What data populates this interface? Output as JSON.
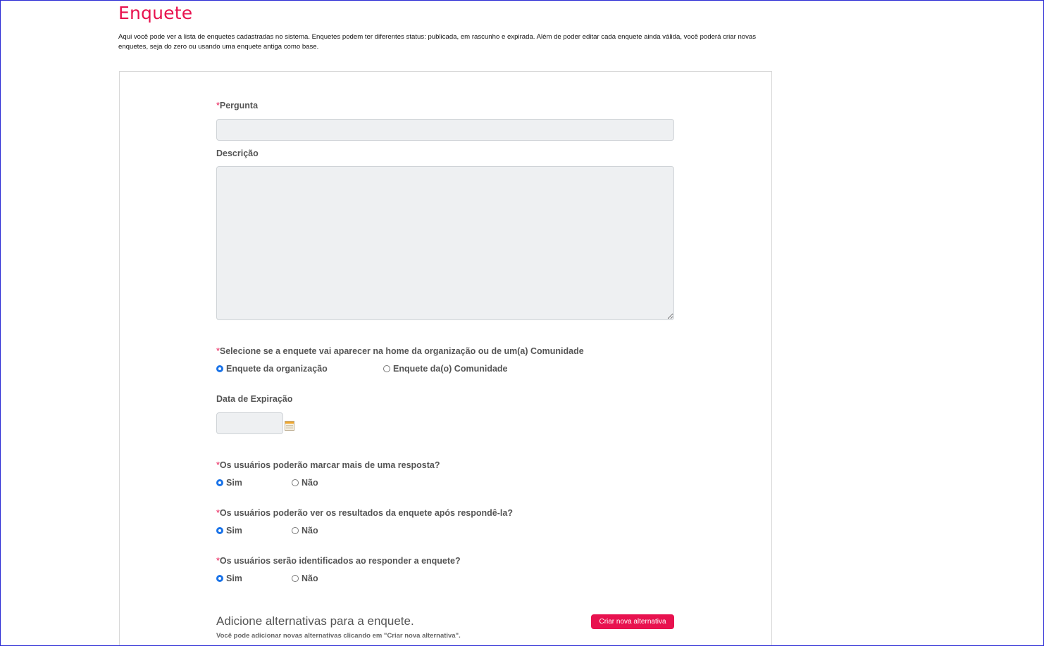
{
  "page": {
    "title": "Enquete",
    "intro": "Aqui você pode ver a lista de enquetes cadastradas no sistema. Enquetes podem ter diferentes status: publicada, em rascunho e expirada. Além de poder editar cada enquete ainda válida, você poderá criar novas enquetes, seja do zero ou usando uma enquete antiga como base."
  },
  "form": {
    "required_mark": "*",
    "question": {
      "label": "Pergunta",
      "value": "",
      "placeholder": ""
    },
    "description": {
      "label": "Descrição",
      "value": "",
      "placeholder": ""
    },
    "visibility": {
      "label": "Selecione se a enquete vai aparecer na home da organização ou de um(a) Comunidade",
      "options": [
        {
          "label": "Enquete da organização",
          "selected": true
        },
        {
          "label": "Enquete da(o) Comunidade",
          "selected": false
        }
      ]
    },
    "expiration": {
      "label": "Data de Expiração",
      "value": "",
      "icon": "calendar-icon"
    },
    "multiple_answers": {
      "label": "Os usuários poderão marcar mais de uma resposta?",
      "yes": "Sim",
      "no": "Não",
      "selected": "yes"
    },
    "show_results": {
      "label": "Os usuários poderão ver os resultados da enquete após respondê-la?",
      "yes": "Sim",
      "no": "Não",
      "selected": "yes"
    },
    "identified": {
      "label": "Os usuários serão identificados ao responder a enquete?",
      "yes": "Sim",
      "no": "Não",
      "selected": "yes"
    }
  },
  "alternatives": {
    "title": "Adicione alternativas para a enquete.",
    "hint": "Você pode adicionar novas alternativas clicando em \"Criar nova alternativa\".",
    "create_button": "Criar nova alternativa"
  },
  "colors": {
    "accent": "#e8124f",
    "radio_checked": "#1a73e8",
    "input_bg": "#eef0f2"
  }
}
